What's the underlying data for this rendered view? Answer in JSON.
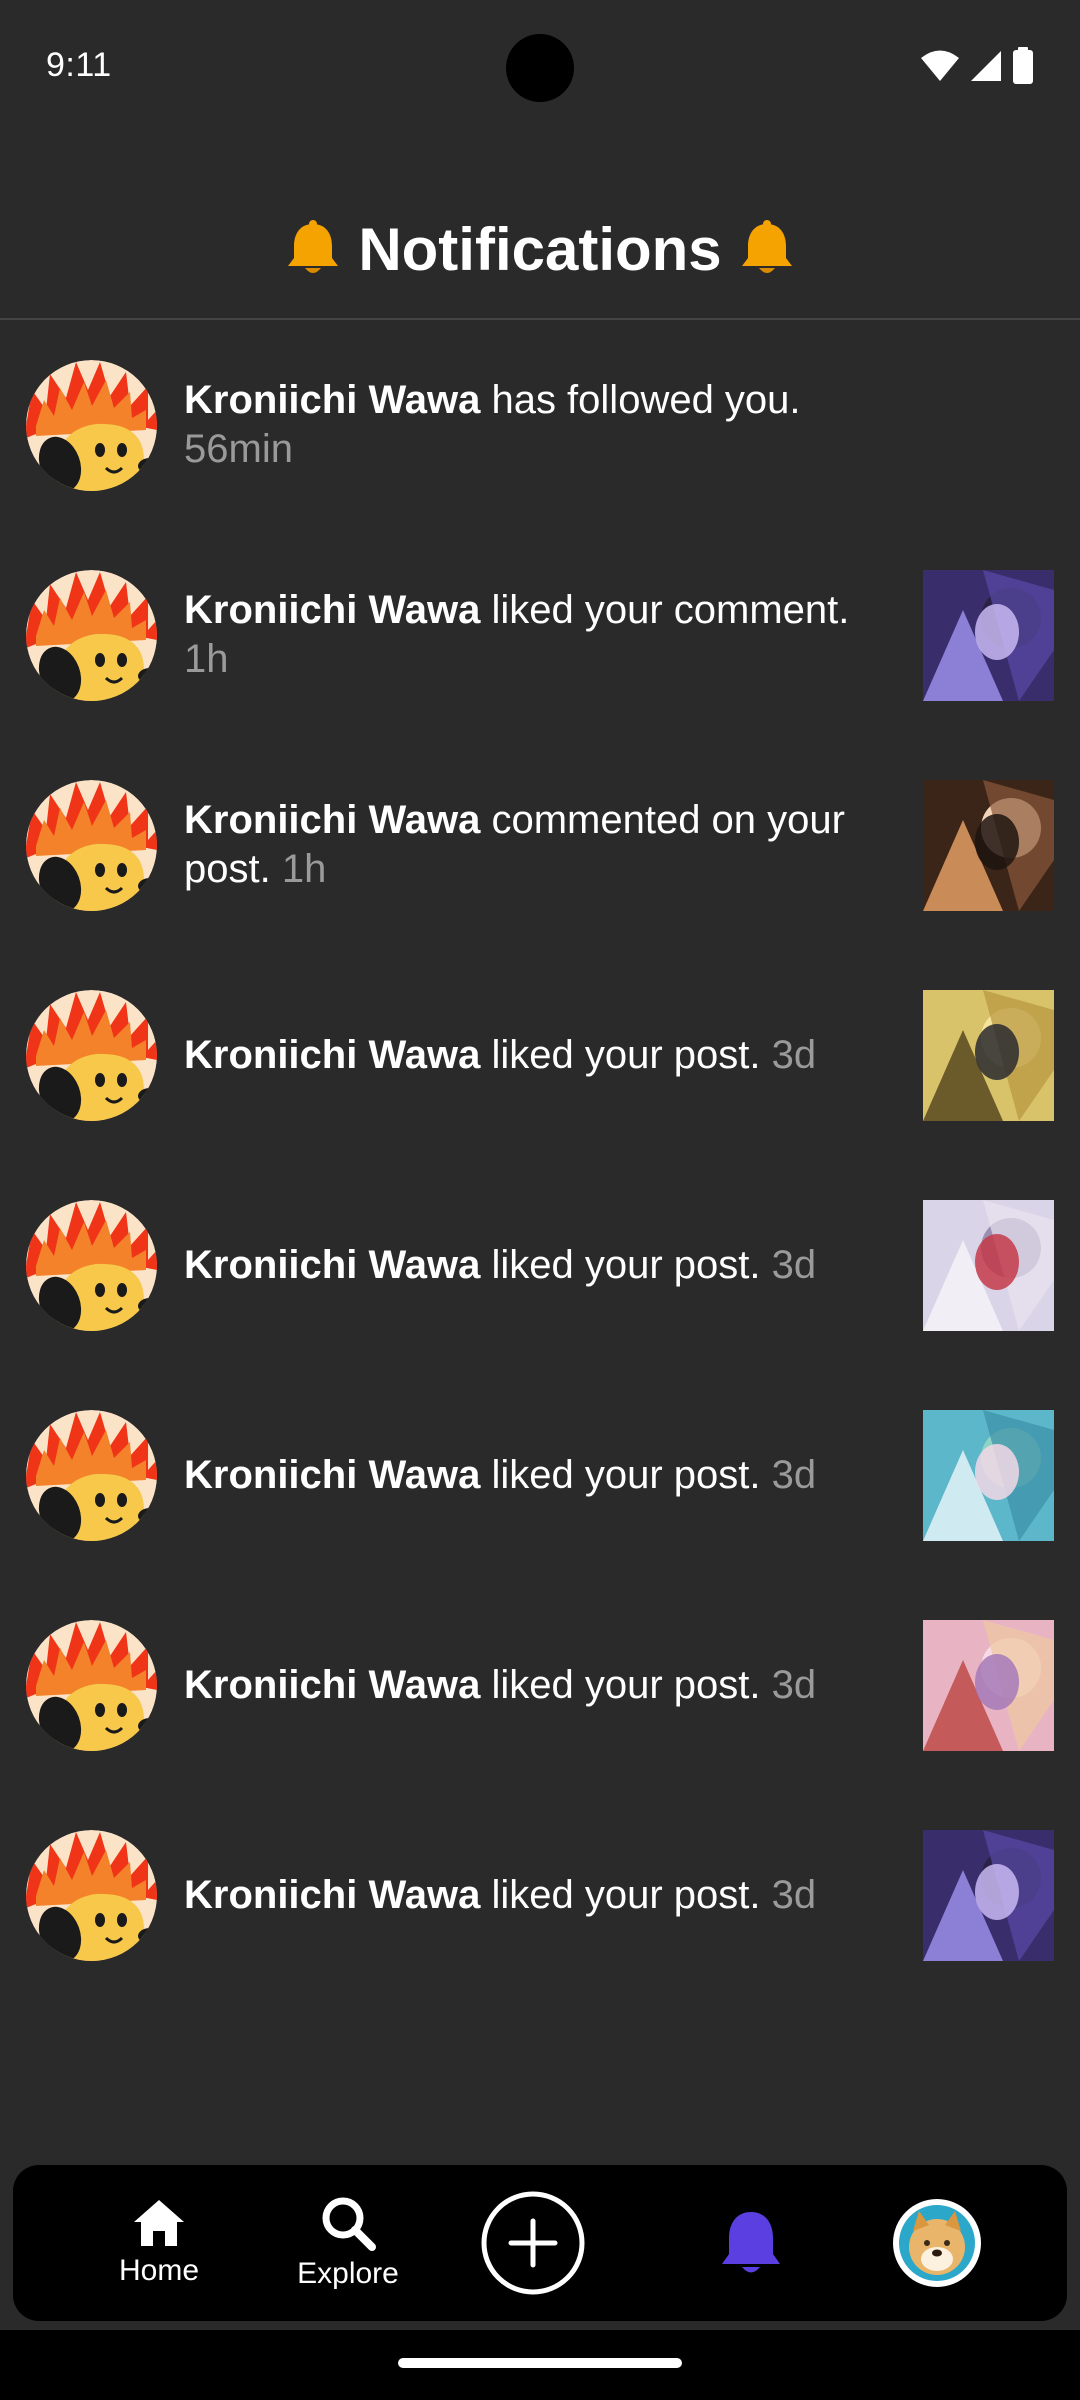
{
  "status_bar": {
    "time": "9:11"
  },
  "header": {
    "title": "Notifications"
  },
  "notifications": [
    {
      "user": "Kroniichi Wawa",
      "action": "has followed you.",
      "time": "56min",
      "thumb": null
    },
    {
      "user": "Kroniichi Wawa",
      "action": "liked your comment.",
      "time": "1h",
      "thumb": "purple-warrior"
    },
    {
      "user": "Kroniichi Wawa",
      "action": "commented on your post.",
      "time": "1h",
      "thumb": "dark-hair-girl"
    },
    {
      "user": "Kroniichi Wawa",
      "action": "liked your post.",
      "time": "3d",
      "thumb": "gold-flowers"
    },
    {
      "user": "Kroniichi Wawa",
      "action": "liked your post.",
      "time": "3d",
      "thumb": "silver-hair-girl"
    },
    {
      "user": "Kroniichi Wawa",
      "action": "liked your post.",
      "time": "3d",
      "thumb": "teal-aqua"
    },
    {
      "user": "Kroniichi Wawa",
      "action": "liked your post.",
      "time": "3d",
      "thumb": "pink-floral"
    },
    {
      "user": "Kroniichi Wawa",
      "action": "liked your post.",
      "time": "3d",
      "thumb": "purple-warrior"
    }
  ],
  "bottom_nav": {
    "home_label": "Home",
    "explore_label": "Explore",
    "active_color": "#5b3fe0"
  },
  "colors": {
    "background": "#2b2a2b",
    "text": "#ffffff",
    "muted": "#9a9a9a",
    "bell": "#f5a300"
  }
}
